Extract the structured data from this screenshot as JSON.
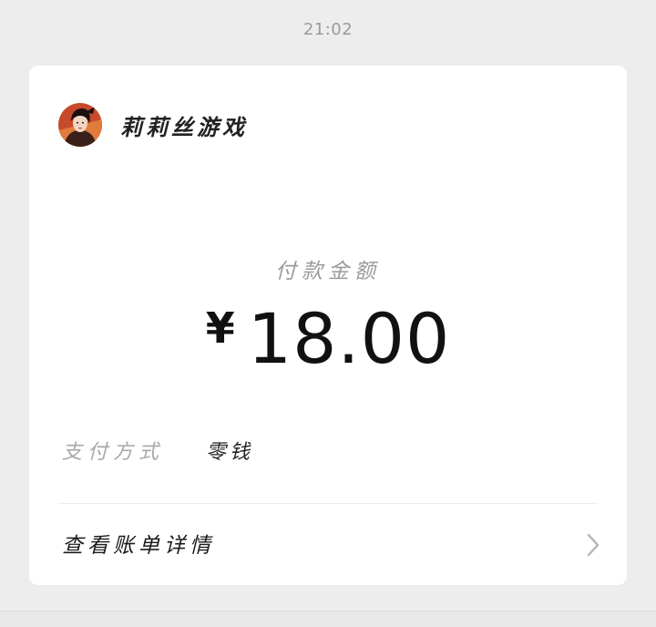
{
  "timestamp": "21:02",
  "merchant": {
    "name": "莉莉丝游戏",
    "avatar_icon": "merchant-avatar"
  },
  "payment": {
    "amount_label": "付款金额",
    "currency_symbol": "¥",
    "amount": "18.00"
  },
  "pay_method": {
    "label": "支付方式",
    "value": "零钱"
  },
  "bill_details": {
    "label": "查看账单详情",
    "icon": "chevron-right-icon"
  },
  "colors": {
    "background": "#ededed",
    "card": "#ffffff",
    "primary_text": "#111111",
    "secondary_text": "#9a9a9a"
  }
}
